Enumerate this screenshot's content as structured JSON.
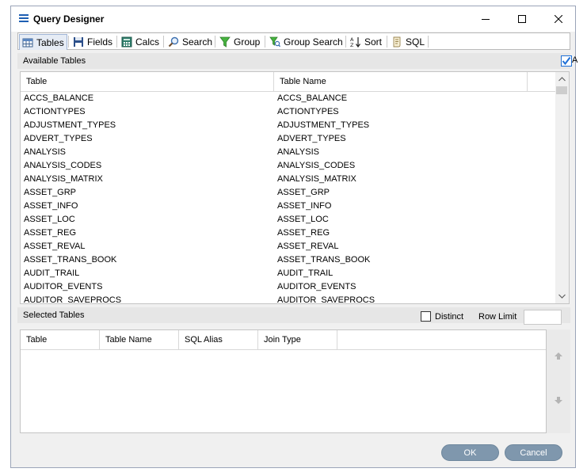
{
  "window": {
    "title": "Query Designer"
  },
  "tabs": [
    {
      "label": "Tables",
      "icon": "table-icon"
    },
    {
      "label": "Fields",
      "icon": "save-icon"
    },
    {
      "label": "Calcs",
      "icon": "calculator-icon"
    },
    {
      "label": "Search",
      "icon": "search-icon"
    },
    {
      "label": "Group",
      "icon": "filter-icon"
    },
    {
      "label": "Group Search",
      "icon": "filter-search-icon"
    },
    {
      "label": "Sort",
      "icon": "sort-az-icon"
    },
    {
      "label": "SQL",
      "icon": "script-icon"
    }
  ],
  "available": {
    "label": "Available Tables",
    "check_label": "A",
    "columns": [
      "Table",
      "Table Name"
    ],
    "rows": [
      [
        "ACCS_BALANCE",
        "ACCS_BALANCE"
      ],
      [
        "ACTIONTYPES",
        "ACTIONTYPES"
      ],
      [
        "ADJUSTMENT_TYPES",
        "ADJUSTMENT_TYPES"
      ],
      [
        "ADVERT_TYPES",
        "ADVERT_TYPES"
      ],
      [
        "ANALYSIS",
        "ANALYSIS"
      ],
      [
        "ANALYSIS_CODES",
        "ANALYSIS_CODES"
      ],
      [
        "ANALYSIS_MATRIX",
        "ANALYSIS_MATRIX"
      ],
      [
        "ASSET_GRP",
        "ASSET_GRP"
      ],
      [
        "ASSET_INFO",
        "ASSET_INFO"
      ],
      [
        "ASSET_LOC",
        "ASSET_LOC"
      ],
      [
        "ASSET_REG",
        "ASSET_REG"
      ],
      [
        "ASSET_REVAL",
        "ASSET_REVAL"
      ],
      [
        "ASSET_TRANS_BOOK",
        "ASSET_TRANS_BOOK"
      ],
      [
        "AUDIT_TRAIL",
        "AUDIT_TRAIL"
      ],
      [
        "AUDITOR_EVENTS",
        "AUDITOR_EVENTS"
      ],
      [
        "AUDITOR_SAVEPROCS",
        "AUDITOR_SAVEPROCS"
      ]
    ]
  },
  "selected": {
    "label": "Selected Tables",
    "distinct_label": "Distinct",
    "row_limit_label": "Row Limit",
    "row_limit_value": "",
    "columns": [
      "Table",
      "Table Name",
      "SQL Alias",
      "Join Type"
    ]
  },
  "buttons": {
    "ok": "OK",
    "cancel": "Cancel"
  },
  "colors": {
    "button": "#7f97ad",
    "check": "#1e6fd6",
    "tab_active": "#e6ecf5"
  }
}
